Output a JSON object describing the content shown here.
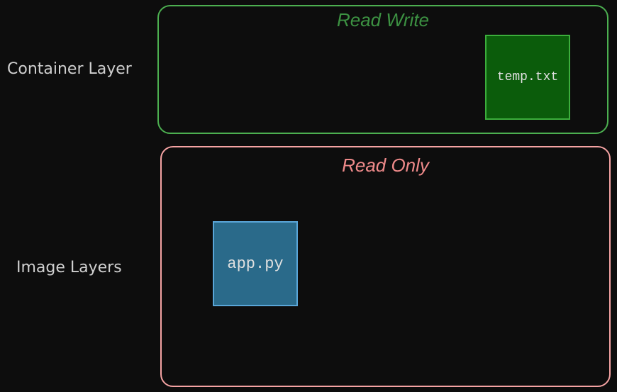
{
  "labels": {
    "container_layer": "Container Layer",
    "image_layers": "Image Layers"
  },
  "read_write_box": {
    "title": "Read Write",
    "files": [
      {
        "name": "temp.txt"
      }
    ]
  },
  "read_only_box": {
    "title": "Read Only",
    "files": [
      {
        "name": "app.py"
      }
    ]
  }
}
